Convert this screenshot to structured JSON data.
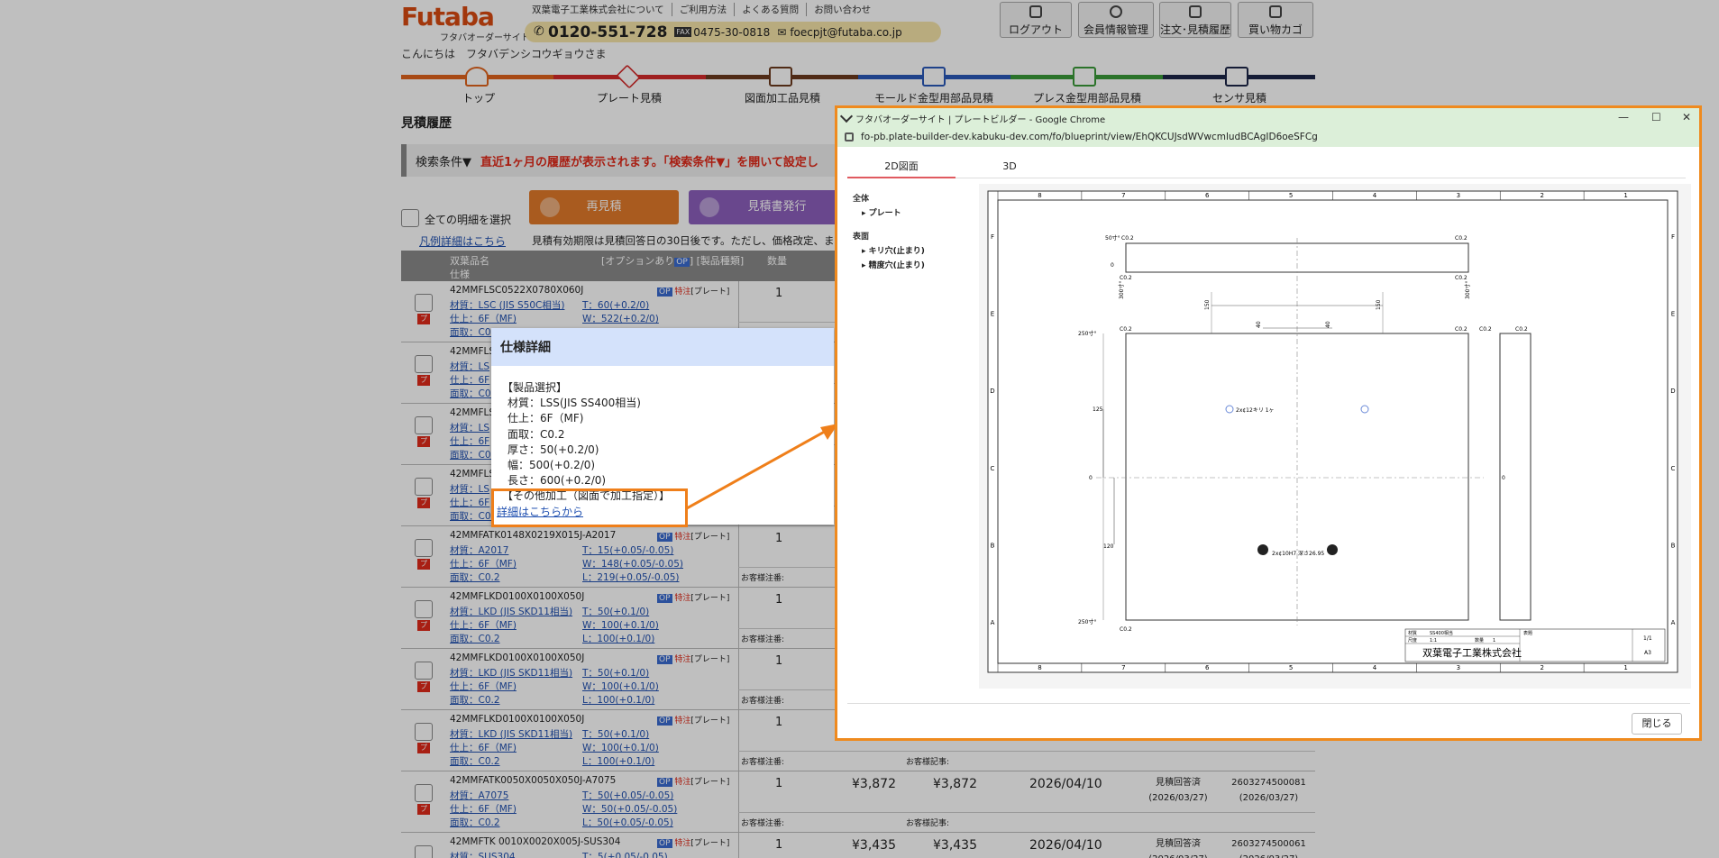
{
  "site": {
    "logo": "Futaba",
    "logo_sub": "フタバオーダーサイト",
    "top_links": [
      "双葉電子工業株式会社について",
      "ご利用方法",
      "よくある質問",
      "お問い合わせ"
    ],
    "tel": "0120-551-728",
    "fax_label": "FAX",
    "fax": "0475-30-0818",
    "email": "foecpjt@futaba.co.jp",
    "greeting": "こんにちは　フタバデンシコウギョウさま",
    "header_buttons": [
      "ログアウト",
      "会員情報管理",
      "注文･見積履歴",
      "買い物カゴ"
    ],
    "nav": [
      "トップ",
      "プレート見積",
      "図面加工品見積",
      "モールド金型用部品見積",
      "プレス金型用部品見積",
      "センサ見積"
    ],
    "nav_colors": [
      "#e0631c",
      "#d42a2a",
      "#6b3a1e",
      "#2a58b8",
      "#3a9a38",
      "#1c2648"
    ],
    "page_title": "見積履歴",
    "search_label": "検索条件▼",
    "search_notice": "直近1ヶ月の履歴が表示されます。「検索条件▼」を開いて設定し",
    "select_all": "全ての明細を選択",
    "reorder_button": "再見積",
    "issue_button": "見積書発行",
    "legend_link": "凡例詳細はこちら",
    "validity_note": "見積有効期限は見積回答日の30日後です。ただし、価格改定、ま",
    "table_head": {
      "product": "双葉品名",
      "finish": "仕様",
      "options": "[オプションあり",
      "options_badge": "OP",
      "category": "] [製品種類]",
      "qty": "数量"
    },
    "rows": [
      {
        "name": "42MMFLSC0522X0780X060J",
        "s1": "材質：LSC (JIS S50C相当)",
        "s2": "仕上：6F（MF)",
        "s3": "面取：C0.2",
        "d1": "T：60(+0.2/0)",
        "d2": "W：522(+0.2/0)",
        "d3": "",
        "qty": "1",
        "unit": "",
        "total": "",
        "date": "",
        "status": "",
        "status_date": "",
        "no": "",
        "no_date": ""
      },
      {
        "name": "42MMFLS",
        "s1": "材質：LS",
        "s2": "仕上：6F",
        "s3": "面取：C0.",
        "d1": "",
        "d2": "",
        "d3": "",
        "qty": "",
        "unit": "",
        "total": "",
        "date": "",
        "status": "",
        "status_date": "",
        "no": "",
        "no_date": ""
      },
      {
        "name": "42MMFLS",
        "s1": "材質：LS",
        "s2": "仕上：6F",
        "s3": "面取：C0.",
        "d1": "",
        "d2": "",
        "d3": "",
        "qty": "",
        "unit": "",
        "total": "",
        "date": "",
        "status": "",
        "status_date": "",
        "no": "",
        "no_date": ""
      },
      {
        "name": "42MMFLS",
        "s1": "材質：LS",
        "s2": "仕上：6F",
        "s3": "面取：C0.",
        "d1": "",
        "d2": "",
        "d3": "",
        "qty": "",
        "unit": "",
        "total": "",
        "date": "",
        "status": "",
        "status_date": "",
        "no": "",
        "no_date": ""
      },
      {
        "name": "42MMFATK0148X0219X015J-A2017",
        "s1": "材質：A2017",
        "s2": "仕上：6F（MF)",
        "s3": "面取：C0.2",
        "d1": "T：15(+0.05/-0.05)",
        "d2": "W：148(+0.05/-0.05)",
        "d3": "L：219(+0.05/-0.05)",
        "qty": "1",
        "unit": "",
        "total": "",
        "date": "",
        "status": "",
        "status_date": "",
        "no": "",
        "no_date": ""
      },
      {
        "name": "42MMFLKD0100X0100X050J",
        "s1": "材質：LKD (JIS SKD11相当)",
        "s2": "仕上：6F（MF)",
        "s3": "面取：C0.2",
        "d1": "T：50(+0.1/0)",
        "d2": "W：100(+0.1/0)",
        "d3": "L：100(+0.1/0)",
        "qty": "1",
        "unit": "",
        "total": "",
        "date": "",
        "status": "",
        "status_date": "",
        "no": "",
        "no_date": ""
      },
      {
        "name": "42MMFLKD0100X0100X050J",
        "s1": "材質：LKD (JIS SKD11相当)",
        "s2": "仕上：6F（MF)",
        "s3": "面取：C0.2",
        "d1": "T：50(+0.1/0)",
        "d2": "W：100(+0.1/0)",
        "d3": "L：100(+0.1/0)",
        "qty": "1",
        "unit": "",
        "total": "",
        "date": "",
        "status": "",
        "status_date": "",
        "no": "",
        "no_date": ""
      },
      {
        "name": "42MMFLKD0100X0100X050J",
        "s1": "材質：LKD (JIS SKD11相当)",
        "s2": "仕上：6F（MF)",
        "s3": "面取：C0.2",
        "d1": "T：50(+0.1/0)",
        "d2": "W：100(+0.1/0)",
        "d3": "L：100(+0.1/0)",
        "qty": "1",
        "unit": "",
        "total": "",
        "date": "",
        "status": "",
        "status_date": "",
        "no": "",
        "no_date": ""
      },
      {
        "name": "42MMFATK0050X0050X050J-A7075",
        "s1": "材質：A7075",
        "s2": "仕上：6F（MF)",
        "s3": "面取：C0.2",
        "d1": "T：50(+0.05/-0.05)",
        "d2": "W：50(+0.05/-0.05)",
        "d3": "L：50(+0.05/-0.05)",
        "qty": "1",
        "unit": "¥3,872",
        "total": "¥3,872",
        "date": "2026/04/10",
        "status": "見積回答済",
        "status_date": "(2026/03/27)",
        "no": "2603274500081",
        "no_date": "(2026/03/27)"
      },
      {
        "name": "42MMFTK 0010X0020X005J-SUS304",
        "s1": "材質：SUS304",
        "s2": "",
        "s3": "",
        "d1": "T：5(+0.05/-0.05)",
        "d2": "",
        "d3": "",
        "qty": "1",
        "unit": "¥3,435",
        "total": "¥3,435",
        "date": "2026/04/10",
        "status": "見積回答済",
        "status_date": "(2026/03/27)",
        "no": "2603274500061",
        "no_date": "(2026/03/27)"
      }
    ],
    "row_tag_op": "OP",
    "row_tag_order": "特注",
    "row_tag_type": "[プレート]",
    "row_badge": "プ",
    "customer_note": "お客様注番:",
    "customer_memo": "お客様記事:"
  },
  "spec_dialog": {
    "title": "仕様詳細",
    "lines": [
      "【製品選択】",
      "材質：LSS(JIS SS400相当)",
      "仕上：6F（MF)",
      "面取：C0.2",
      "厚さ：50(+0.2/0)",
      "幅：500(+0.2/0)",
      "長さ：600(+0.2/0)",
      "【その他加工（図面で加工指定）】"
    ],
    "link": "詳細はこちらから"
  },
  "popup": {
    "window_title": "フタバオーダーサイト | プレートビルダー - Google Chrome",
    "url": "fo-pb.plate-builder-dev.kabuku-dev.com/fo/blueprint/view/EhQKCUJsdWVwcmludBCAgID6oeSFCg",
    "tabs": [
      "2D図面",
      "3D"
    ],
    "tree": {
      "group1": "全体",
      "item1": "▸ プレート",
      "group2": "表面",
      "item2": "▸ キリ穴(止まり)",
      "item3": "▸ 精度穴(止まり)"
    },
    "close_button": "閉じる",
    "blueprint": {
      "col_labels": [
        "8",
        "7",
        "6",
        "5",
        "4",
        "3",
        "2",
        "1"
      ],
      "row_labels": [
        "F",
        "E",
        "D",
        "C",
        "B",
        "A"
      ],
      "dims": {
        "d50": "50寸°",
        "d300a": "300寸°",
        "d300b": "300寸°",
        "d250a": "250寸°",
        "d250b": "250寸°",
        "d150a": "150",
        "d150b": "150",
        "d40a": "40",
        "d40b": "40",
        "d125": "125",
        "d120": "120",
        "c02": "C0.2",
        "z": "0",
        "hole1": "2x¢12キリ 1ヶ",
        "hole2": "2x¢10H7 深さ26.95"
      },
      "title_block": {
        "company": "双葉電子工業株式会社",
        "material_label": "材質",
        "material": "SS400相当",
        "scale_label": "尺度",
        "scale": "1:1",
        "qty_label": "数量",
        "qty": "1",
        "sheet_label": "表題",
        "sheet": "1/1",
        "size": "A3"
      }
    }
  }
}
